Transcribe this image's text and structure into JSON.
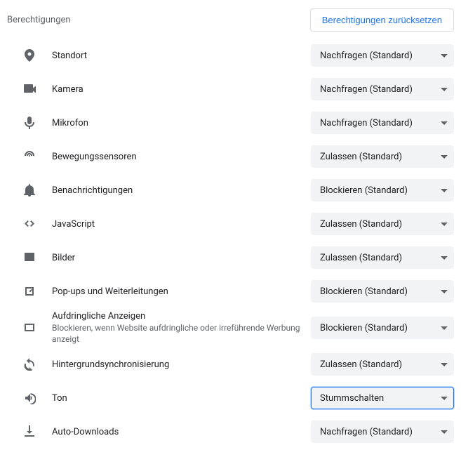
{
  "header": {
    "title": "Berechtigungen",
    "reset_label": "Berechtigungen zurücksetzen"
  },
  "permissions": [
    {
      "icon": "location",
      "label": "Standort",
      "sub": "",
      "value": "Nachfragen (Standard)",
      "focused": false
    },
    {
      "icon": "camera",
      "label": "Kamera",
      "sub": "",
      "value": "Nachfragen (Standard)",
      "focused": false
    },
    {
      "icon": "mic",
      "label": "Mikrofon",
      "sub": "",
      "value": "Nachfragen (Standard)",
      "focused": false
    },
    {
      "icon": "motion",
      "label": "Bewegungssensoren",
      "sub": "",
      "value": "Zulassen (Standard)",
      "focused": false
    },
    {
      "icon": "bell",
      "label": "Benachrichtigungen",
      "sub": "",
      "value": "Blockieren (Standard)",
      "focused": false
    },
    {
      "icon": "code",
      "label": "JavaScript",
      "sub": "",
      "value": "Zulassen (Standard)",
      "focused": false
    },
    {
      "icon": "image",
      "label": "Bilder",
      "sub": "",
      "value": "Zulassen (Standard)",
      "focused": false
    },
    {
      "icon": "popup",
      "label": "Pop-ups und Weiterleitungen",
      "sub": "",
      "value": "Blockieren (Standard)",
      "focused": false
    },
    {
      "icon": "ads",
      "label": "Aufdringliche Anzeigen",
      "sub": "Blockieren, wenn Website aufdringliche oder irreführende Werbung anzeigt",
      "value": "Blockieren (Standard)",
      "focused": false
    },
    {
      "icon": "sync",
      "label": "Hintergrundsynchronisierung",
      "sub": "",
      "value": "Zulassen (Standard)",
      "focused": false
    },
    {
      "icon": "sound",
      "label": "Ton",
      "sub": "",
      "value": "Stummschalten",
      "focused": true
    },
    {
      "icon": "download",
      "label": "Auto-Downloads",
      "sub": "",
      "value": "Nachfragen (Standard)",
      "focused": false
    }
  ]
}
